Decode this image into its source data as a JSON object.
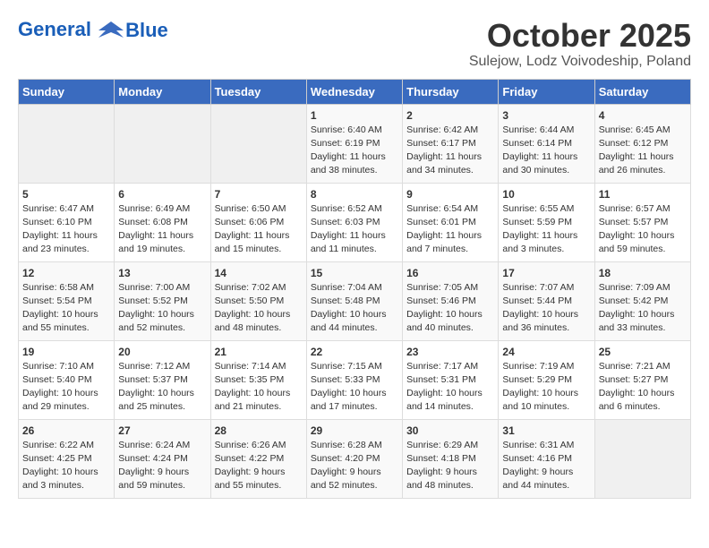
{
  "header": {
    "logo_line1": "General",
    "logo_line2": "Blue",
    "month": "October 2025",
    "location": "Sulejow, Lodz Voivodeship, Poland"
  },
  "days_of_week": [
    "Sunday",
    "Monday",
    "Tuesday",
    "Wednesday",
    "Thursday",
    "Friday",
    "Saturday"
  ],
  "weeks": [
    [
      {
        "day": "",
        "sunrise": "",
        "sunset": "",
        "daylight": ""
      },
      {
        "day": "",
        "sunrise": "",
        "sunset": "",
        "daylight": ""
      },
      {
        "day": "",
        "sunrise": "",
        "sunset": "",
        "daylight": ""
      },
      {
        "day": "1",
        "sunrise": "Sunrise: 6:40 AM",
        "sunset": "Sunset: 6:19 PM",
        "daylight": "Daylight: 11 hours and 38 minutes."
      },
      {
        "day": "2",
        "sunrise": "Sunrise: 6:42 AM",
        "sunset": "Sunset: 6:17 PM",
        "daylight": "Daylight: 11 hours and 34 minutes."
      },
      {
        "day": "3",
        "sunrise": "Sunrise: 6:44 AM",
        "sunset": "Sunset: 6:14 PM",
        "daylight": "Daylight: 11 hours and 30 minutes."
      },
      {
        "day": "4",
        "sunrise": "Sunrise: 6:45 AM",
        "sunset": "Sunset: 6:12 PM",
        "daylight": "Daylight: 11 hours and 26 minutes."
      }
    ],
    [
      {
        "day": "5",
        "sunrise": "Sunrise: 6:47 AM",
        "sunset": "Sunset: 6:10 PM",
        "daylight": "Daylight: 11 hours and 23 minutes."
      },
      {
        "day": "6",
        "sunrise": "Sunrise: 6:49 AM",
        "sunset": "Sunset: 6:08 PM",
        "daylight": "Daylight: 11 hours and 19 minutes."
      },
      {
        "day": "7",
        "sunrise": "Sunrise: 6:50 AM",
        "sunset": "Sunset: 6:06 PM",
        "daylight": "Daylight: 11 hours and 15 minutes."
      },
      {
        "day": "8",
        "sunrise": "Sunrise: 6:52 AM",
        "sunset": "Sunset: 6:03 PM",
        "daylight": "Daylight: 11 hours and 11 minutes."
      },
      {
        "day": "9",
        "sunrise": "Sunrise: 6:54 AM",
        "sunset": "Sunset: 6:01 PM",
        "daylight": "Daylight: 11 hours and 7 minutes."
      },
      {
        "day": "10",
        "sunrise": "Sunrise: 6:55 AM",
        "sunset": "Sunset: 5:59 PM",
        "daylight": "Daylight: 11 hours and 3 minutes."
      },
      {
        "day": "11",
        "sunrise": "Sunrise: 6:57 AM",
        "sunset": "Sunset: 5:57 PM",
        "daylight": "Daylight: 10 hours and 59 minutes."
      }
    ],
    [
      {
        "day": "12",
        "sunrise": "Sunrise: 6:58 AM",
        "sunset": "Sunset: 5:54 PM",
        "daylight": "Daylight: 10 hours and 55 minutes."
      },
      {
        "day": "13",
        "sunrise": "Sunrise: 7:00 AM",
        "sunset": "Sunset: 5:52 PM",
        "daylight": "Daylight: 10 hours and 52 minutes."
      },
      {
        "day": "14",
        "sunrise": "Sunrise: 7:02 AM",
        "sunset": "Sunset: 5:50 PM",
        "daylight": "Daylight: 10 hours and 48 minutes."
      },
      {
        "day": "15",
        "sunrise": "Sunrise: 7:04 AM",
        "sunset": "Sunset: 5:48 PM",
        "daylight": "Daylight: 10 hours and 44 minutes."
      },
      {
        "day": "16",
        "sunrise": "Sunrise: 7:05 AM",
        "sunset": "Sunset: 5:46 PM",
        "daylight": "Daylight: 10 hours and 40 minutes."
      },
      {
        "day": "17",
        "sunrise": "Sunrise: 7:07 AM",
        "sunset": "Sunset: 5:44 PM",
        "daylight": "Daylight: 10 hours and 36 minutes."
      },
      {
        "day": "18",
        "sunrise": "Sunrise: 7:09 AM",
        "sunset": "Sunset: 5:42 PM",
        "daylight": "Daylight: 10 hours and 33 minutes."
      }
    ],
    [
      {
        "day": "19",
        "sunrise": "Sunrise: 7:10 AM",
        "sunset": "Sunset: 5:40 PM",
        "daylight": "Daylight: 10 hours and 29 minutes."
      },
      {
        "day": "20",
        "sunrise": "Sunrise: 7:12 AM",
        "sunset": "Sunset: 5:37 PM",
        "daylight": "Daylight: 10 hours and 25 minutes."
      },
      {
        "day": "21",
        "sunrise": "Sunrise: 7:14 AM",
        "sunset": "Sunset: 5:35 PM",
        "daylight": "Daylight: 10 hours and 21 minutes."
      },
      {
        "day": "22",
        "sunrise": "Sunrise: 7:15 AM",
        "sunset": "Sunset: 5:33 PM",
        "daylight": "Daylight: 10 hours and 17 minutes."
      },
      {
        "day": "23",
        "sunrise": "Sunrise: 7:17 AM",
        "sunset": "Sunset: 5:31 PM",
        "daylight": "Daylight: 10 hours and 14 minutes."
      },
      {
        "day": "24",
        "sunrise": "Sunrise: 7:19 AM",
        "sunset": "Sunset: 5:29 PM",
        "daylight": "Daylight: 10 hours and 10 minutes."
      },
      {
        "day": "25",
        "sunrise": "Sunrise: 7:21 AM",
        "sunset": "Sunset: 5:27 PM",
        "daylight": "Daylight: 10 hours and 6 minutes."
      }
    ],
    [
      {
        "day": "26",
        "sunrise": "Sunrise: 6:22 AM",
        "sunset": "Sunset: 4:25 PM",
        "daylight": "Daylight: 10 hours and 3 minutes."
      },
      {
        "day": "27",
        "sunrise": "Sunrise: 6:24 AM",
        "sunset": "Sunset: 4:24 PM",
        "daylight": "Daylight: 9 hours and 59 minutes."
      },
      {
        "day": "28",
        "sunrise": "Sunrise: 6:26 AM",
        "sunset": "Sunset: 4:22 PM",
        "daylight": "Daylight: 9 hours and 55 minutes."
      },
      {
        "day": "29",
        "sunrise": "Sunrise: 6:28 AM",
        "sunset": "Sunset: 4:20 PM",
        "daylight": "Daylight: 9 hours and 52 minutes."
      },
      {
        "day": "30",
        "sunrise": "Sunrise: 6:29 AM",
        "sunset": "Sunset: 4:18 PM",
        "daylight": "Daylight: 9 hours and 48 minutes."
      },
      {
        "day": "31",
        "sunrise": "Sunrise: 6:31 AM",
        "sunset": "Sunset: 4:16 PM",
        "daylight": "Daylight: 9 hours and 44 minutes."
      },
      {
        "day": "",
        "sunrise": "",
        "sunset": "",
        "daylight": ""
      }
    ]
  ]
}
